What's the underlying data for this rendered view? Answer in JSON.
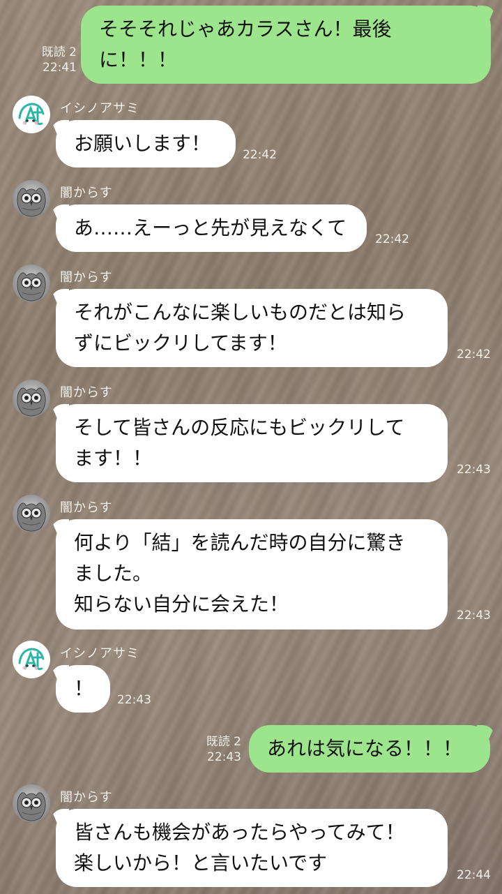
{
  "messages": [
    {
      "side": "right",
      "read_label": "既読 2",
      "time": "22:41",
      "text": "そそそれじゃあカラスさん！最後\nに！！！"
    },
    {
      "side": "left",
      "sender": "イシノアサミ",
      "avatar": "asami",
      "time": "22:42",
      "text": "お願いします！"
    },
    {
      "side": "left",
      "sender": "闇からす",
      "avatar": "owl",
      "time": "22:42",
      "text": "あ……えーっと先が見えなくて"
    },
    {
      "side": "left",
      "sender": "闇からす",
      "avatar": "owl",
      "time": "22:42",
      "text": "それがこんなに楽しいものだとは知ら\nずにビックリしてます！"
    },
    {
      "side": "left",
      "sender": "闇からす",
      "avatar": "owl",
      "time": "22:43",
      "text": "そして皆さんの反応にもビックリして\nます！！"
    },
    {
      "side": "left",
      "sender": "闇からす",
      "avatar": "owl",
      "time": "22:43",
      "text": "何より「結」を読んだ時の自分に驚き\nました。\n知らない自分に会えた！"
    },
    {
      "side": "left",
      "sender": "イシノアサミ",
      "avatar": "asami",
      "time": "22:43",
      "text": "！"
    },
    {
      "side": "right",
      "read_label": "既読 2",
      "time": "22:43",
      "text": "あれは気になる！！！"
    },
    {
      "side": "left",
      "sender": "闇からす",
      "avatar": "owl",
      "time": "22:44",
      "text": "皆さんも機会があったらやってみて！\n楽しいから！と言いたいです"
    }
  ],
  "colors": {
    "background": "#8f8070",
    "sent_bubble": "#9ce58c",
    "received_bubble": "#ffffff",
    "meta_text": "#f3f0eb"
  },
  "icons": {
    "owl_avatar": "owl-avatar-icon",
    "asami_avatar": "asami-avatar-icon"
  }
}
